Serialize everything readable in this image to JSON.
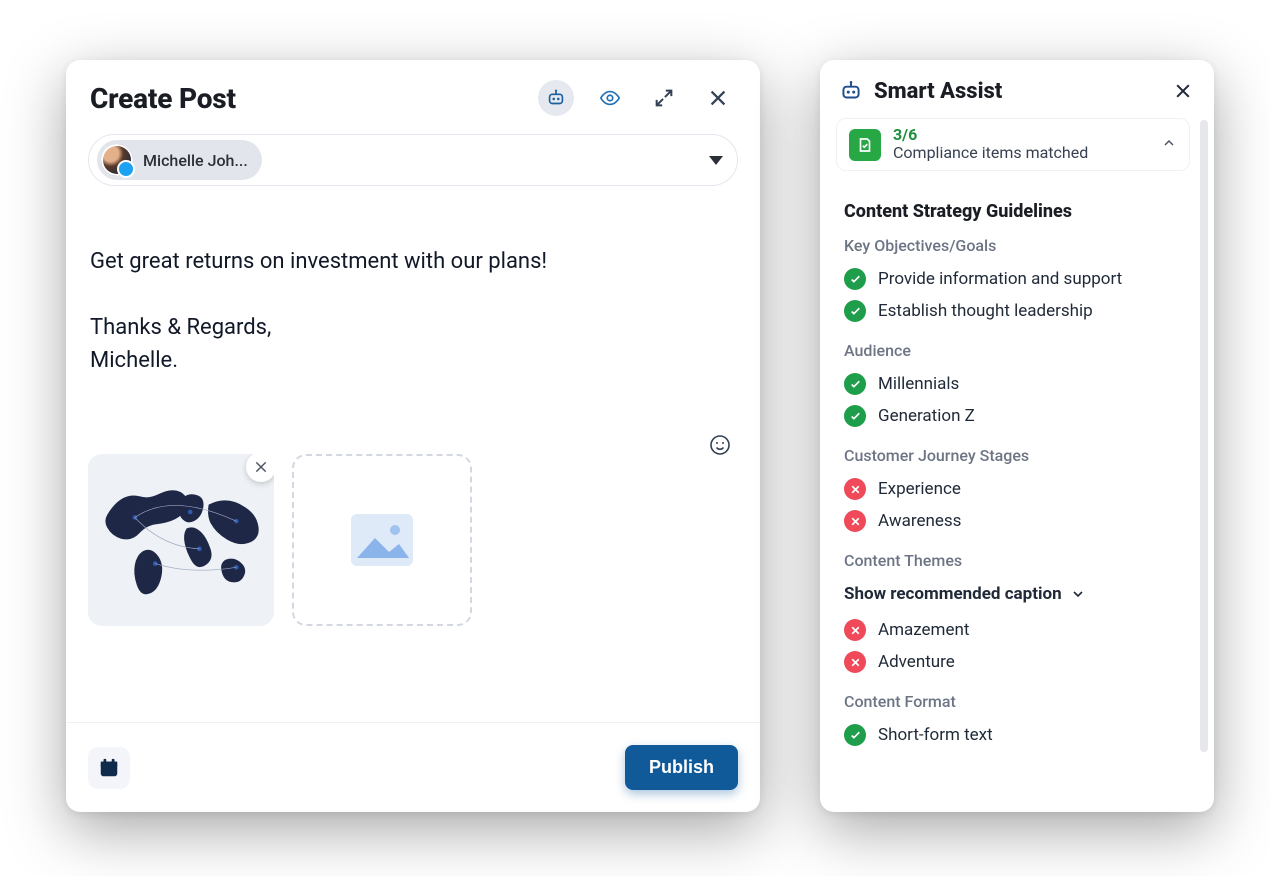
{
  "compose_panel": {
    "title": "Create Post",
    "account_chip": "Michelle Joh...",
    "body_text": "Get great returns on investment with our plans!\n\nThanks & Regards,\nMichelle.",
    "publish_label": "Publish"
  },
  "smart_assist": {
    "title": "Smart Assist",
    "compliance": {
      "count": "3/6",
      "label": "Compliance items matched"
    },
    "guidelines_heading": "Content Strategy Guidelines",
    "show_recommended_label": "Show recommended caption",
    "sections": {
      "key_objectives": {
        "heading": "Key Objectives/Goals",
        "items": [
          {
            "label": "Provide information and support",
            "status": "ok"
          },
          {
            "label": "Establish thought leadership",
            "status": "ok"
          }
        ]
      },
      "audience": {
        "heading": "Audience",
        "items": [
          {
            "label": "Millennials",
            "status": "ok"
          },
          {
            "label": "Generation Z",
            "status": "ok"
          }
        ]
      },
      "journey": {
        "heading": "Customer Journey Stages",
        "items": [
          {
            "label": "Experience",
            "status": "bad"
          },
          {
            "label": "Awareness",
            "status": "bad"
          }
        ]
      },
      "themes": {
        "heading": "Content Themes",
        "items": [
          {
            "label": "Amazement",
            "status": "bad"
          },
          {
            "label": "Adventure",
            "status": "bad"
          }
        ]
      },
      "format": {
        "heading": "Content Format",
        "items": [
          {
            "label": "Short-form text",
            "status": "ok"
          }
        ]
      }
    }
  }
}
